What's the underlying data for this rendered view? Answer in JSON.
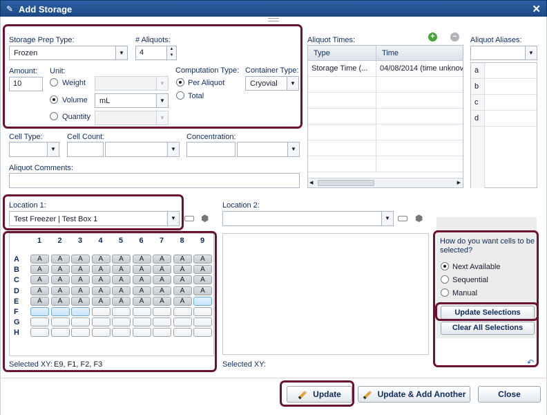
{
  "dialog": {
    "title": "Add Storage",
    "close_glyph": "✕"
  },
  "prep": {
    "storage_prep_type_label": "Storage Prep Type:",
    "storage_prep_type_value": "Frozen",
    "aliquots_label": "# Aliquots:",
    "aliquots_value": "4",
    "amount_label": "Amount:",
    "amount_value": "10",
    "unit_label": "Unit:",
    "unit_options": [
      {
        "label": "Weight",
        "selected": false,
        "value": ""
      },
      {
        "label": "Volume",
        "selected": true,
        "value": "mL"
      },
      {
        "label": "Quantity",
        "selected": false,
        "value": ""
      }
    ],
    "computation_type_label": "Computation Type:",
    "computation_options": [
      {
        "label": "Per Aliquot",
        "selected": true
      },
      {
        "label": "Total",
        "selected": false
      }
    ],
    "container_type_label": "Container Type:",
    "container_type_value": "Cryovial"
  },
  "cell": {
    "cell_type_label": "Cell Type:",
    "cell_count_label": "Cell Count:",
    "concentration_label": "Concentration:",
    "aliquot_comments_label": "Aliquot Comments:"
  },
  "aliquot_times": {
    "label": "Aliquot Times:",
    "columns": [
      "Type",
      "Time"
    ],
    "rows": [
      [
        "Storage Time (...",
        "04/08/2014 (time unknov"
      ]
    ]
  },
  "aliquot_aliases": {
    "label": "Aliquot Aliases:",
    "rows": [
      "a",
      "b",
      "c",
      "d"
    ]
  },
  "location1": {
    "label": "Location 1:",
    "value": "Test Freezer | Test Box 1",
    "columns": [
      "1",
      "2",
      "3",
      "4",
      "5",
      "6",
      "7",
      "8",
      "9"
    ],
    "rows": [
      "A",
      "B",
      "C",
      "D",
      "E",
      "F",
      "G",
      "H"
    ],
    "occupied_mark": "A",
    "selected_xy_label": "Selected XY:",
    "selected_xy_value": "E9, F1, F2, F3"
  },
  "location2": {
    "label": "Location 2:",
    "value": "",
    "selected_xy_label": "Selected XY:"
  },
  "selection_panel": {
    "question": "How do you want cells to be selected?",
    "options": [
      {
        "label": "Next Available",
        "selected": true
      },
      {
        "label": "Sequential",
        "selected": false
      },
      {
        "label": "Manual",
        "selected": false
      }
    ],
    "update_selections_label": "Update Selections",
    "clear_all_label": "Clear All Selections"
  },
  "footer": {
    "update_label": "Update",
    "update_add_label": "Update & Add Another",
    "close_label": "Close"
  },
  "colors": {
    "titlebar": "#1d4a86",
    "highlight": "#6b1233",
    "label": "#0e2a5c"
  }
}
